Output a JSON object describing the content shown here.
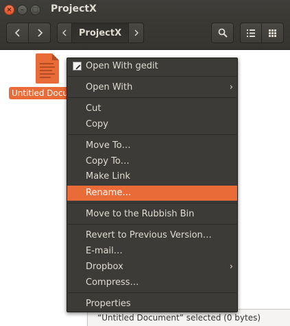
{
  "window": {
    "title": "ProjectX"
  },
  "toolbar": {
    "back_icon": "chevron-left-icon",
    "forward_icon": "chevron-right-icon",
    "crumb_left_icon": "chevron-left-icon",
    "crumb_right_icon": "chevron-right-icon",
    "breadcrumb": "ProjectX",
    "search_icon": "search-icon",
    "list_view_icon": "list-view-icon",
    "grid_view_icon": "grid-view-icon"
  },
  "file": {
    "name": "Untitled Document"
  },
  "context_menu": {
    "items": [
      {
        "label": "Open With gedit"
      },
      {
        "label": "Open With"
      },
      {
        "label": "Cut"
      },
      {
        "label": "Copy"
      },
      {
        "label": "Move To…"
      },
      {
        "label": "Copy To…"
      },
      {
        "label": "Make Link"
      },
      {
        "label": "Rename…"
      },
      {
        "label": "Move to the Rubbish Bin"
      },
      {
        "label": "Revert to Previous Version…"
      },
      {
        "label": "E-mail…"
      },
      {
        "label": "Dropbox"
      },
      {
        "label": "Compress…"
      },
      {
        "label": "Properties"
      }
    ]
  },
  "statusbar": {
    "text": "“Untitled Document” selected  (0 bytes)"
  },
  "colors": {
    "accent": "#e96b37",
    "header": "#3c3b37",
    "menu": "#3c3b37"
  }
}
